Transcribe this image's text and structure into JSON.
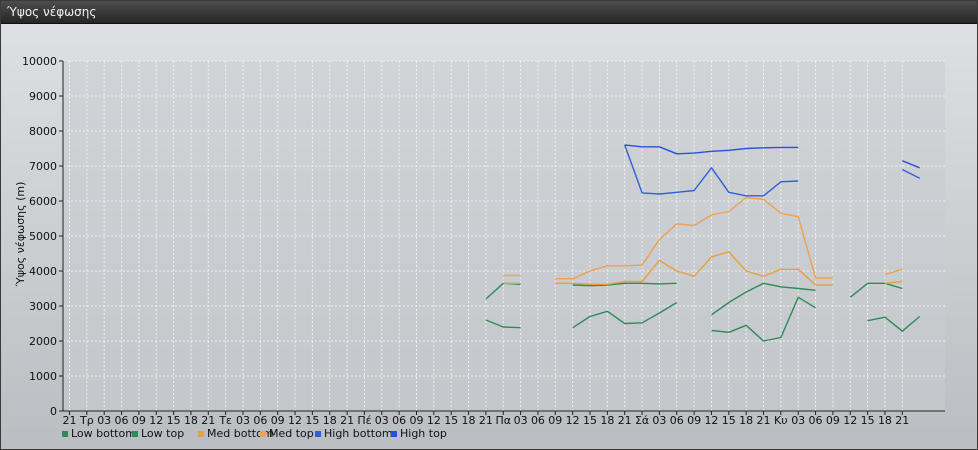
{
  "window": {
    "title": "Ύψος νέφωσης"
  },
  "chart_data": {
    "type": "line",
    "title": "",
    "ylabel": "Ύψος νέφωσης (m)",
    "xlabel": "",
    "ylim": [
      0,
      10000
    ],
    "yticks": [
      0,
      1000,
      2000,
      3000,
      4000,
      5000,
      6000,
      7000,
      8000,
      9000,
      10000
    ],
    "x_tick_labels": [
      "21",
      "Τρ",
      "03",
      "06",
      "09",
      "12",
      "15",
      "18",
      "21",
      "Τε",
      "03",
      "06",
      "09",
      "12",
      "15",
      "18",
      "21",
      "Πέ",
      "03",
      "06",
      "09",
      "12",
      "15",
      "18",
      "21",
      "Πα",
      "03",
      "06",
      "09",
      "12",
      "15",
      "18",
      "21",
      "Σά",
      "03",
      "06",
      "09",
      "12",
      "15",
      "18",
      "21",
      "Κυ",
      "03",
      "06",
      "09",
      "12",
      "15",
      "18",
      "21"
    ],
    "grid": true,
    "legend_position": "bottom-left",
    "series": [
      {
        "name": "Low bottom",
        "color": "#2e8b57",
        "values": [
          null,
          null,
          null,
          null,
          null,
          null,
          null,
          null,
          null,
          null,
          null,
          null,
          null,
          null,
          null,
          null,
          null,
          null,
          null,
          null,
          null,
          null,
          null,
          null,
          2600,
          2400,
          2380,
          null,
          null,
          2380,
          2700,
          2850,
          2500,
          2520,
          2800,
          3100,
          null,
          2300,
          2250,
          2450,
          2000,
          2100,
          3250,
          2950,
          null,
          null,
          2580,
          2680,
          2280,
          2700
        ]
      },
      {
        "name": "Low top",
        "color": "#2e8b57",
        "values": [
          null,
          null,
          null,
          null,
          null,
          null,
          null,
          null,
          null,
          null,
          null,
          null,
          null,
          null,
          null,
          null,
          null,
          null,
          null,
          null,
          null,
          null,
          null,
          null,
          3200,
          3650,
          3620,
          null,
          null,
          3600,
          3580,
          3600,
          3650,
          3650,
          3630,
          3650,
          null,
          2750,
          3100,
          3400,
          3650,
          3550,
          3500,
          3450,
          null,
          3250,
          3650,
          3650,
          3500,
          null
        ]
      },
      {
        "name": "Med bottom",
        "color": "#e8a040",
        "values": [
          null,
          null,
          null,
          null,
          null,
          null,
          null,
          null,
          null,
          null,
          null,
          null,
          null,
          null,
          null,
          null,
          null,
          null,
          null,
          null,
          null,
          null,
          null,
          null,
          null,
          3650,
          3650,
          null,
          3650,
          3650,
          3620,
          3620,
          3700,
          3700,
          4300,
          4000,
          3850,
          4400,
          4550,
          4000,
          3850,
          4050,
          4050,
          3600,
          3600,
          null,
          null,
          3650,
          3700,
          null
        ]
      },
      {
        "name": "Med top",
        "color": "#f0a050",
        "values": [
          null,
          null,
          null,
          null,
          null,
          null,
          null,
          null,
          null,
          null,
          null,
          null,
          null,
          null,
          null,
          null,
          null,
          null,
          null,
          null,
          null,
          null,
          null,
          null,
          null,
          3870,
          3870,
          null,
          3780,
          3780,
          4000,
          4150,
          4150,
          4170,
          4900,
          5350,
          5300,
          5600,
          5700,
          6100,
          6050,
          5650,
          5550,
          3800,
          3800,
          null,
          null,
          3900,
          4050,
          null
        ]
      },
      {
        "name": "High bottom",
        "color": "#3060d8",
        "values": [
          null,
          null,
          null,
          null,
          null,
          null,
          null,
          null,
          null,
          null,
          null,
          null,
          null,
          null,
          null,
          null,
          null,
          null,
          null,
          null,
          null,
          null,
          null,
          null,
          null,
          null,
          null,
          null,
          null,
          null,
          null,
          null,
          7600,
          6230,
          6200,
          6250,
          6300,
          6950,
          6250,
          6150,
          6150,
          6550,
          6570,
          null,
          null,
          null,
          null,
          null,
          6900,
          6650
        ]
      },
      {
        "name": "High top",
        "color": "#2850e0",
        "values": [
          null,
          null,
          null,
          null,
          null,
          null,
          null,
          null,
          null,
          null,
          null,
          null,
          null,
          null,
          null,
          null,
          null,
          null,
          null,
          null,
          null,
          null,
          null,
          null,
          null,
          null,
          null,
          null,
          null,
          null,
          null,
          null,
          7600,
          7550,
          7550,
          7350,
          7370,
          7420,
          7450,
          7500,
          7520,
          7530,
          7530,
          null,
          null,
          null,
          null,
          null,
          7150,
          6950
        ]
      }
    ]
  }
}
